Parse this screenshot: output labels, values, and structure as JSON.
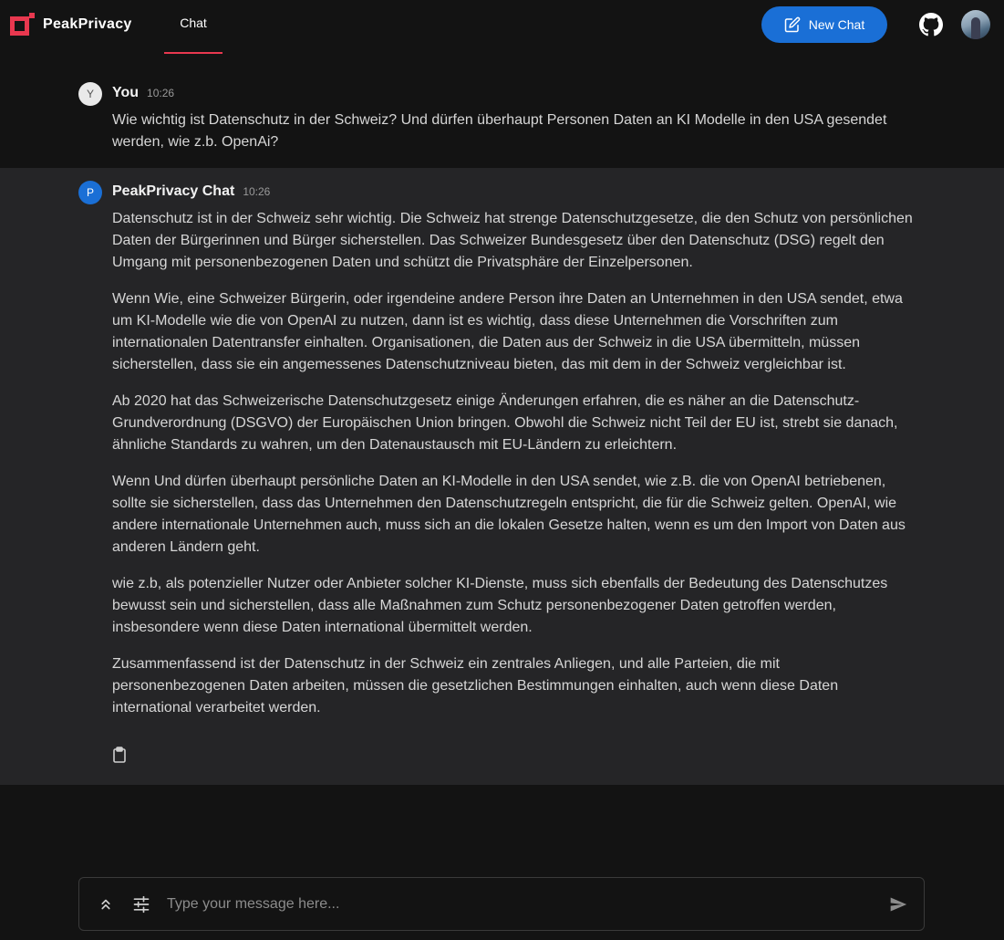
{
  "header": {
    "brand": "PeakPrivacy",
    "nav_tab": "Chat",
    "new_chat_label": "New Chat"
  },
  "messages": [
    {
      "avatar_letter": "Y",
      "sender": "You",
      "time": "10:26",
      "paragraphs": [
        "Wie wichtig ist Datenschutz in der Schweiz? Und dürfen überhaupt Personen Daten an KI Modelle in den USA gesendet werden, wie z.b. OpenAi?"
      ]
    },
    {
      "avatar_letter": "P",
      "sender": "PeakPrivacy Chat",
      "time": "10:26",
      "paragraphs": [
        "Datenschutz ist in der Schweiz sehr wichtig. Die Schweiz hat strenge Datenschutzgesetze, die den Schutz von persönlichen Daten der Bürgerinnen und Bürger sicherstellen. Das Schweizer Bundesgesetz über den Datenschutz (DSG) regelt den Umgang mit personenbezogenen Daten und schützt die Privatsphäre der Einzelpersonen.",
        "Wenn Wie, eine Schweizer Bürgerin, oder irgendeine andere Person ihre Daten an Unternehmen in den USA sendet, etwa um KI-Modelle wie die von OpenAI zu nutzen, dann ist es wichtig, dass diese Unternehmen die Vorschriften zum internationalen Datentransfer einhalten. Organisationen, die Daten aus der Schweiz in die USA übermitteln, müssen sicherstellen, dass sie ein angemessenes Datenschutzniveau bieten, das mit dem in der Schweiz vergleichbar ist.",
        "Ab 2020 hat das Schweizerische Datenschutzgesetz einige Änderungen erfahren, die es näher an die Datenschutz-Grundverordnung (DSGVO) der Europäischen Union bringen. Obwohl die Schweiz nicht Teil der EU ist, strebt sie danach, ähnliche Standards zu wahren, um den Datenaustausch mit EU-Ländern zu erleichtern.",
        "Wenn Und dürfen überhaupt persönliche Daten an KI-Modelle in den USA sendet, wie z.B. die von OpenAI betriebenen, sollte sie sicherstellen, dass das Unternehmen den Datenschutzregeln entspricht, die für die Schweiz gelten. OpenAI, wie andere internationale Unternehmen auch, muss sich an die lokalen Gesetze halten, wenn es um den Import von Daten aus anderen Ländern geht.",
        "wie z.b, als potenzieller Nutzer oder Anbieter solcher KI-Dienste, muss sich ebenfalls der Bedeutung des Datenschutzes bewusst sein und sicherstellen, dass alle Maßnahmen zum Schutz personenbezogener Daten getroffen werden, insbesondere wenn diese Daten international übermittelt werden.",
        "Zusammenfassend ist der Datenschutz in der Schweiz ein zentrales Anliegen, und alle Parteien, die mit personenbezogenen Daten arbeiten, müssen die gesetzlichen Bestimmungen einhalten, auch wenn diese Daten international verarbeitet werden."
      ]
    }
  ],
  "composer": {
    "placeholder": "Type your message here...",
    "value": ""
  },
  "colors": {
    "accent": "#1a6fd6",
    "brand": "#e8384f",
    "background": "#131313",
    "bot_message_bg": "#252527"
  },
  "icons": {
    "new_chat": "edit-icon",
    "github": "github-icon",
    "copy": "clipboard-icon",
    "expand": "chevrons-up-icon",
    "settings": "sliders-icon",
    "send": "send-icon"
  }
}
